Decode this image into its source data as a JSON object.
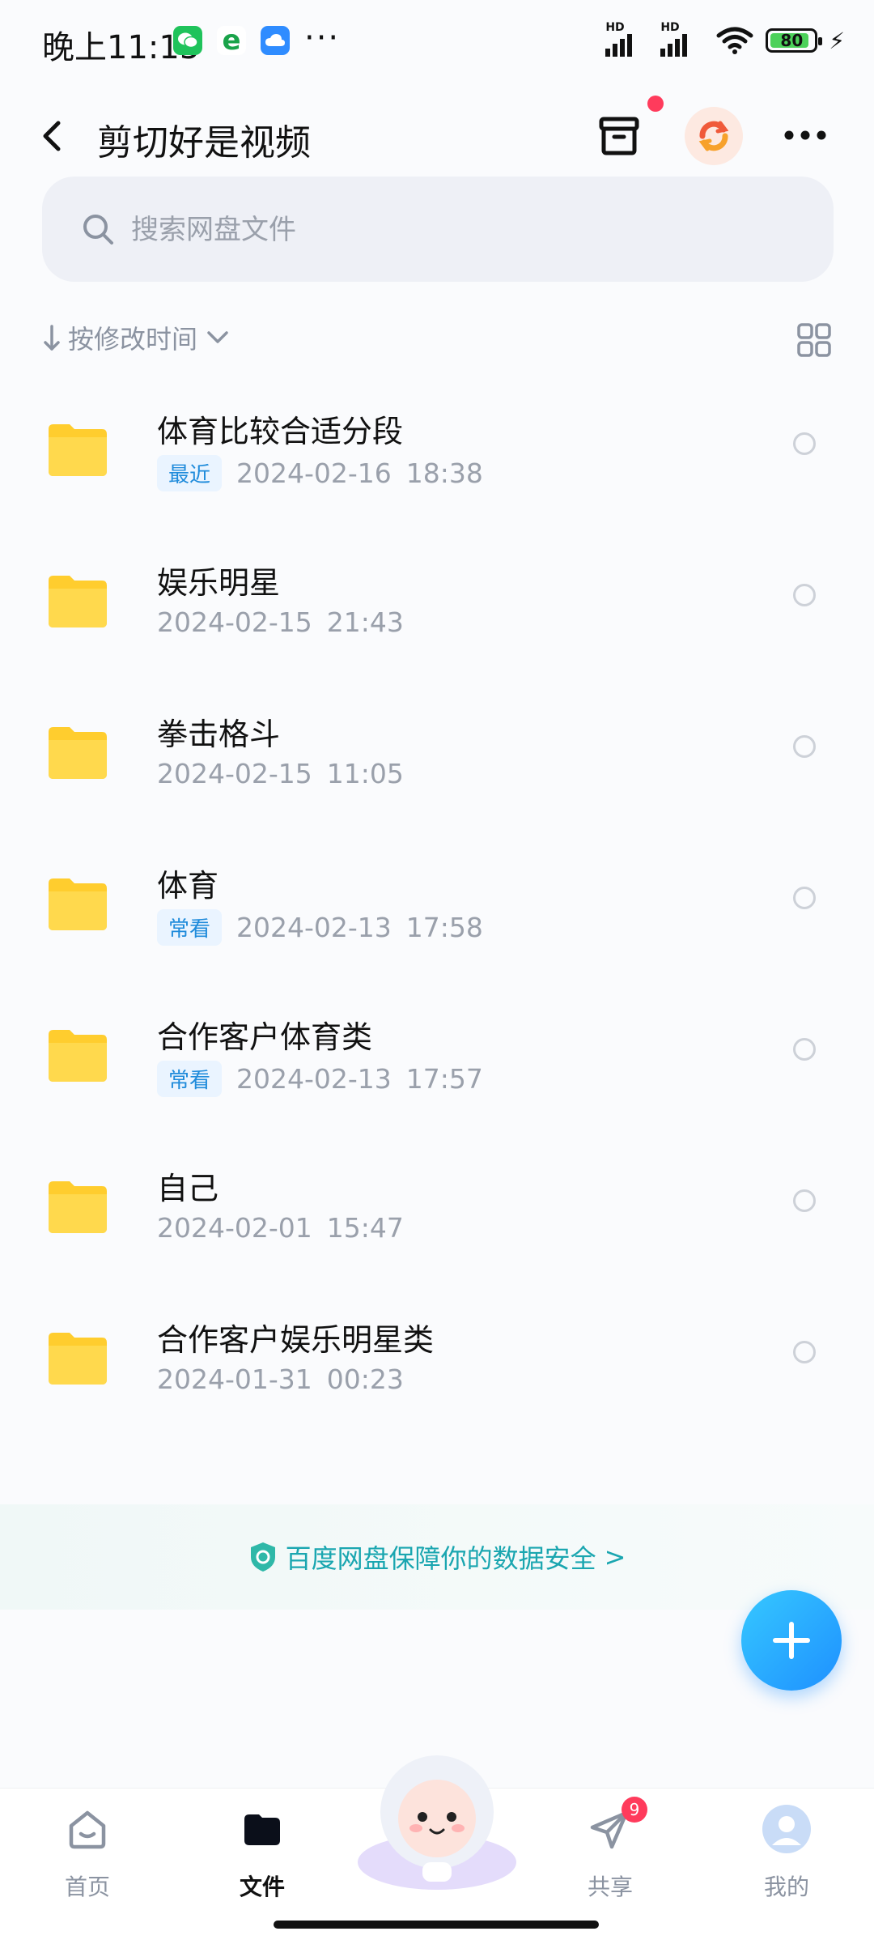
{
  "status_bar": {
    "time": "晚上11:15",
    "signal_label": "HD",
    "battery": "80"
  },
  "header": {
    "title": "剪切好是视频"
  },
  "search": {
    "placeholder": "搜索网盘文件"
  },
  "sort": {
    "label": "按修改时间"
  },
  "files": [
    {
      "name": "体育比较合适分段",
      "tag": "最近",
      "date": "2024-02-16",
      "time": "18:38"
    },
    {
      "name": "娱乐明星",
      "tag": "",
      "date": "2024-02-15",
      "time": "21:43"
    },
    {
      "name": "拳击格斗",
      "tag": "",
      "date": "2024-02-15",
      "time": "11:05"
    },
    {
      "name": "体育",
      "tag": "常看",
      "date": "2024-02-13",
      "time": "17:58"
    },
    {
      "name": "合作客户体育类",
      "tag": "常看",
      "date": "2024-02-13",
      "time": "17:57"
    },
    {
      "name": "自己",
      "tag": "",
      "date": "2024-02-01",
      "time": "15:47"
    },
    {
      "name": "合作客户娱乐明星类",
      "tag": "",
      "date": "2024-01-31",
      "time": "00:23"
    }
  ],
  "safety_banner": {
    "text": "百度网盘保障你的数据安全",
    "arrow": ">"
  },
  "nav": {
    "home": "首页",
    "files": "文件",
    "share": "共享",
    "share_badge": "9",
    "mine": "我的"
  },
  "colors": {
    "accent": "#1e90ff",
    "tag_text": "#1f8bdb",
    "tag_bg": "#eaf4ff",
    "folder": "#ffcd2e",
    "badge": "#ff3b5c"
  }
}
